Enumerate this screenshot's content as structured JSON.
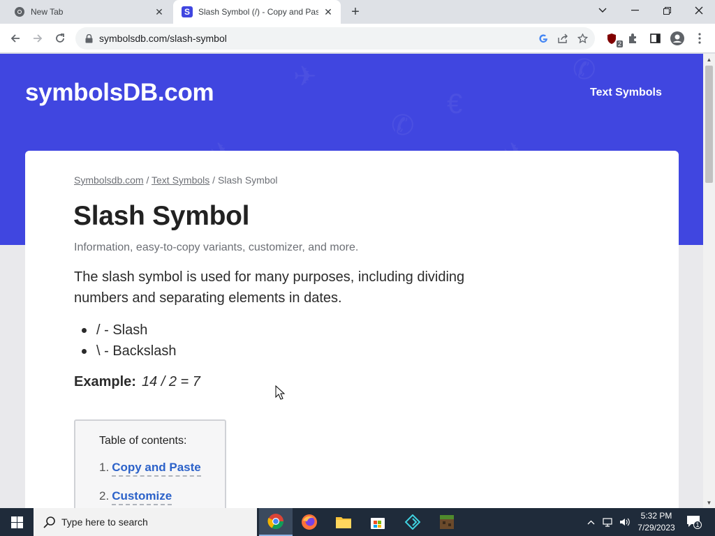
{
  "browser": {
    "tabs": [
      {
        "title": "New Tab",
        "icon": "chrome-icon"
      },
      {
        "title": "Slash Symbol (/) - Copy and Paste",
        "icon": "symbolsdb-favicon",
        "favicon_letter": "S"
      }
    ],
    "address_bar": {
      "url": "symbolsdb.com/slash-symbol"
    },
    "extension_badge": "2"
  },
  "site": {
    "logo": "symbolsDB.com",
    "nav": {
      "text_symbols": "Text Symbols"
    },
    "accent_color": "#4046e0"
  },
  "page": {
    "breadcrumb": {
      "home": "Symbolsdb.com",
      "sep1": " / ",
      "section": "Text Symbols",
      "sep2": " / ",
      "current": "Slash Symbol"
    },
    "title": "Slash Symbol",
    "subtitle": "Information, easy-to-copy variants, customizer, and more.",
    "intro": "The slash symbol is used for many purposes, including dividing numbers and separating elements in dates.",
    "symbols": [
      "/ - Slash",
      "\\ - Backslash"
    ],
    "example": {
      "label": "Example:",
      "value": "14 / 2 = 7"
    },
    "toc": {
      "title": "Table of contents:",
      "items": [
        {
          "num": "1.",
          "label": "Copy and Paste"
        },
        {
          "num": "2.",
          "label": "Customize"
        }
      ]
    }
  },
  "taskbar": {
    "search_placeholder": "Type here to search",
    "time": "5:32 PM",
    "date": "7/29/2023",
    "notification_count": "1"
  }
}
